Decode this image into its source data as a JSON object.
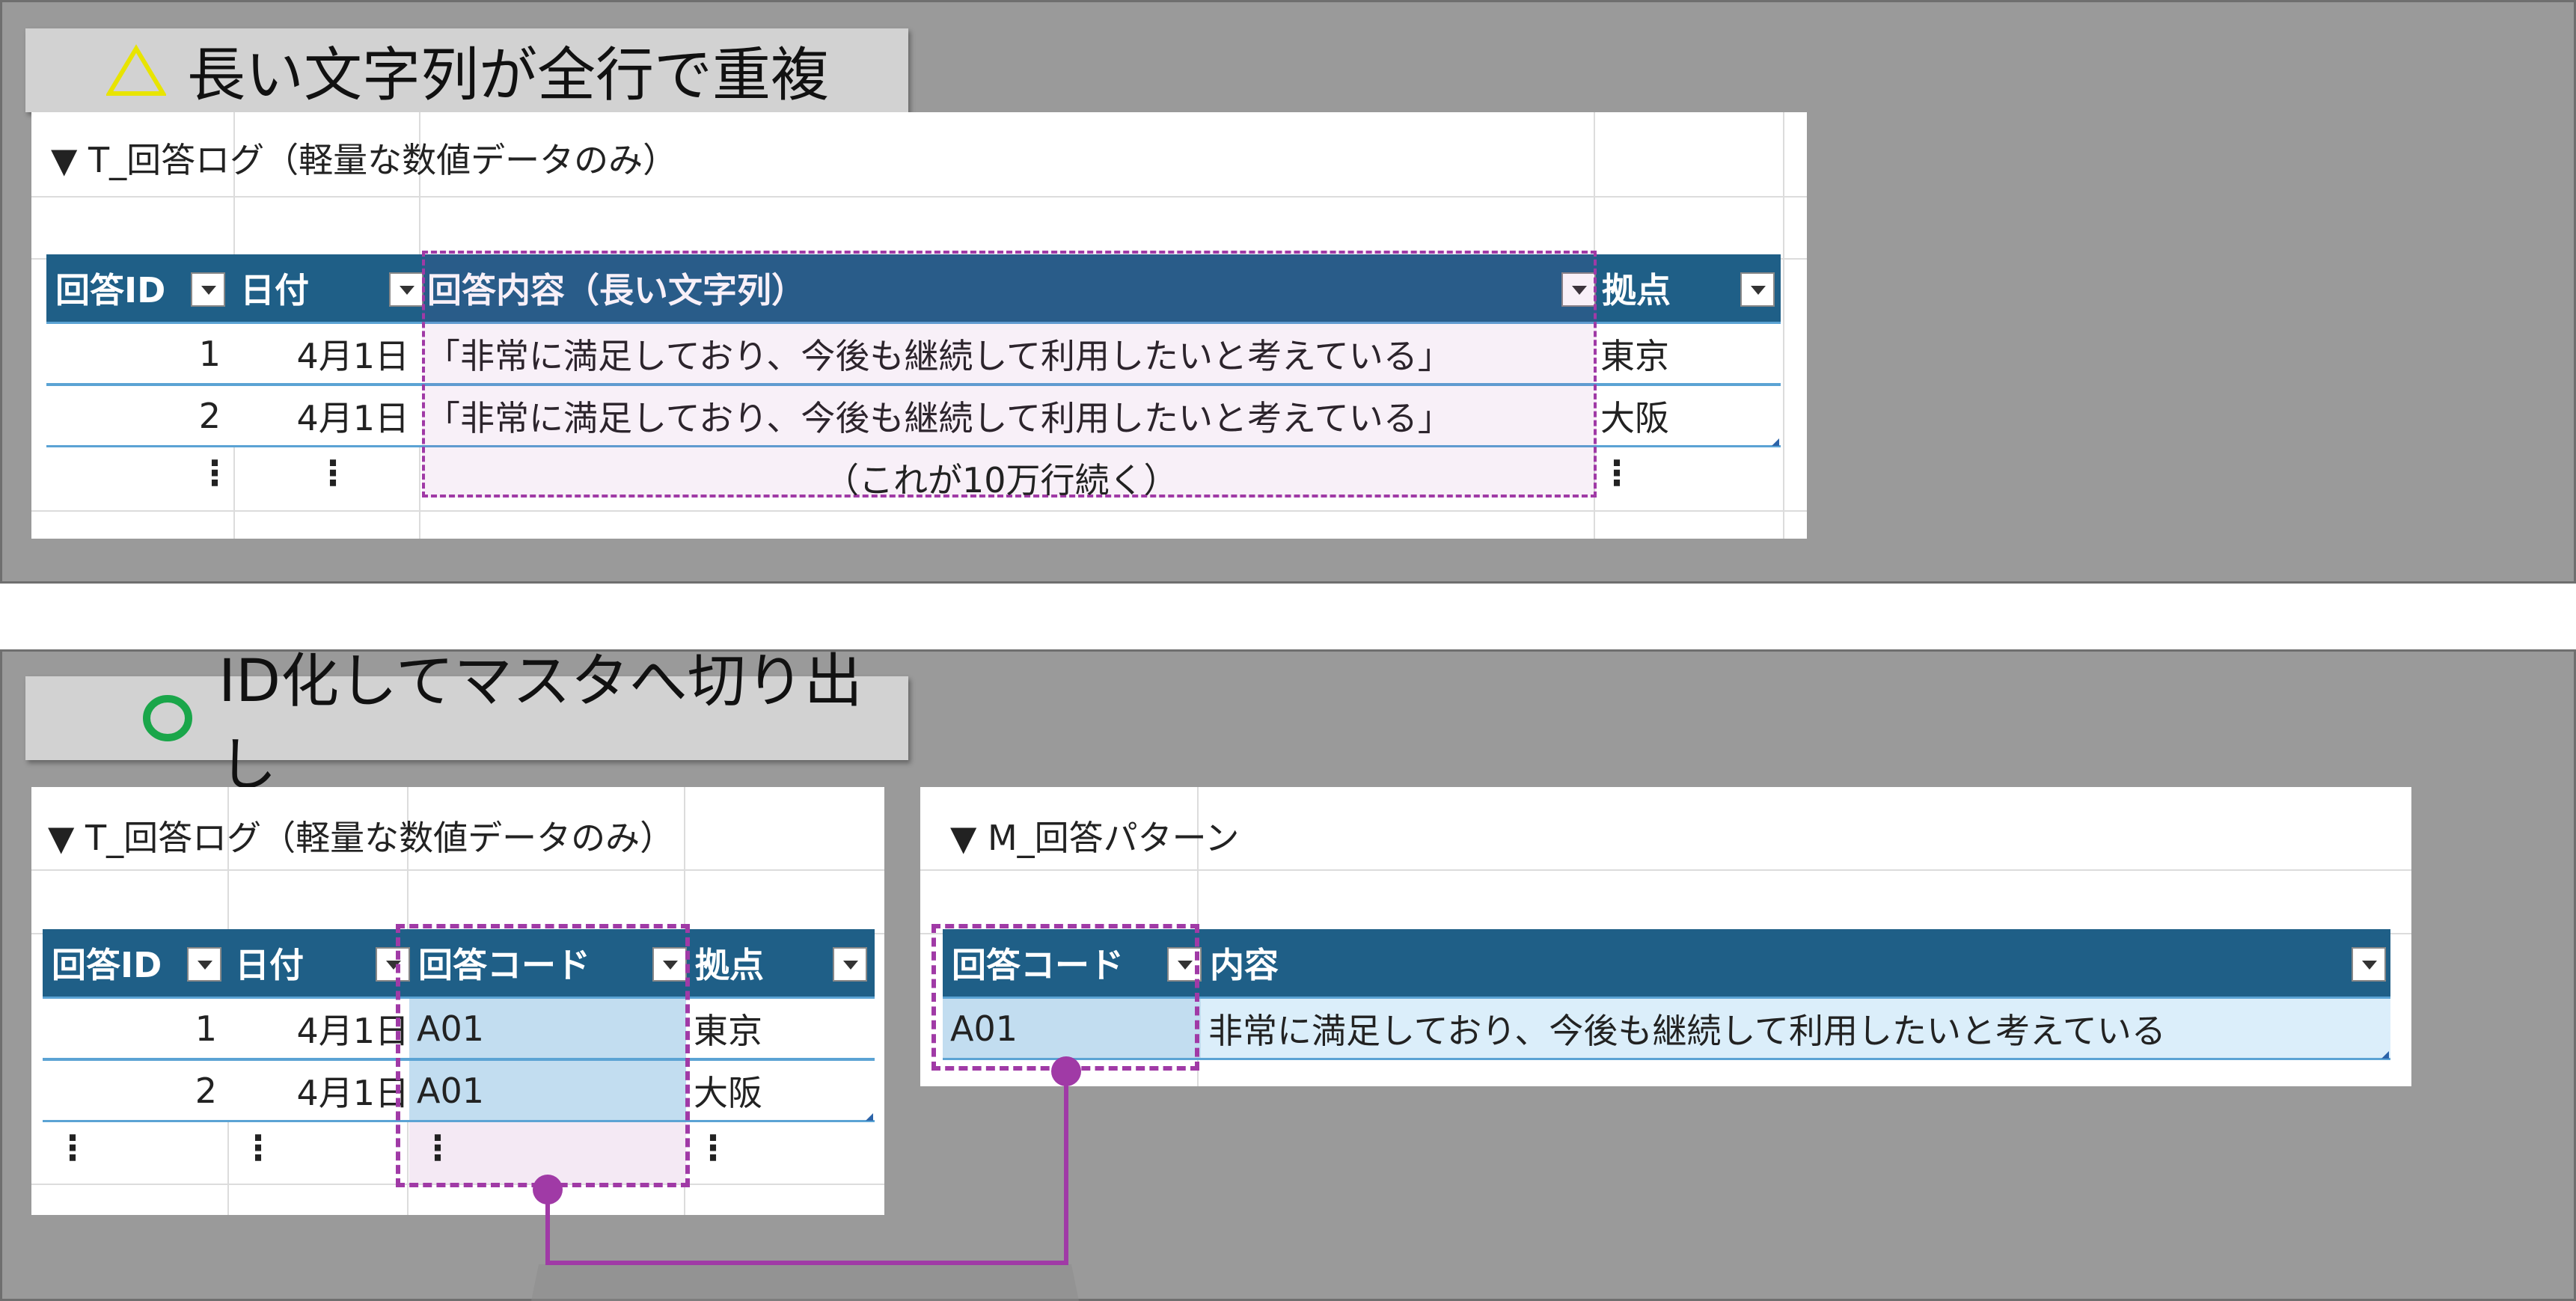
{
  "top_panel": {
    "badge": {
      "mark": "△",
      "label": "長い文字列が全行で重複"
    },
    "sheet": {
      "title": "▼ T_回答ログ（軽量な数値データのみ）",
      "columns": [
        "回答ID",
        "日付",
        "回答内容（長い文字列）",
        "拠点"
      ],
      "rows": [
        {
          "id": "1",
          "date": "4月1日",
          "content": "「非常に満足しており、今後も継続して利用したいと考えている」",
          "location": "東京"
        },
        {
          "id": "2",
          "date": "4月1日",
          "content": "「非常に満足しており、今後も継続して利用したいと考えている」",
          "location": "大阪"
        }
      ],
      "ellipsis": "⋮",
      "continuation_note": "（これが10万行続く）"
    }
  },
  "bottom_panel": {
    "badge": {
      "mark": "○",
      "label": "ID化してマスタへ切り出し"
    },
    "log_sheet": {
      "title": "▼ T_回答ログ（軽量な数値データのみ）",
      "columns": [
        "回答ID",
        "日付",
        "回答コード",
        "拠点"
      ],
      "rows": [
        {
          "id": "1",
          "date": "4月1日",
          "code": "A01",
          "location": "東京"
        },
        {
          "id": "2",
          "date": "4月1日",
          "code": "A01",
          "location": "大阪"
        }
      ],
      "ellipsis": "⋮"
    },
    "master_sheet": {
      "title": "▼ M_回答パターン",
      "columns": [
        "回答コード",
        "内容"
      ],
      "rows": [
        {
          "code": "A01",
          "content": "非常に満足しており、今後も継続して利用したいと考えている"
        }
      ]
    }
  },
  "colors": {
    "panel_bg": "#9a9a9a",
    "badge_bg": "#d2d2d2",
    "header_bg": "#1f5f87",
    "row_border": "#5ba3d4",
    "highlight": "#a03aa6",
    "warn_mark": "#e8e400",
    "ok_mark": "#1aa64a",
    "code_cell_bg": "#c2ddf0"
  }
}
